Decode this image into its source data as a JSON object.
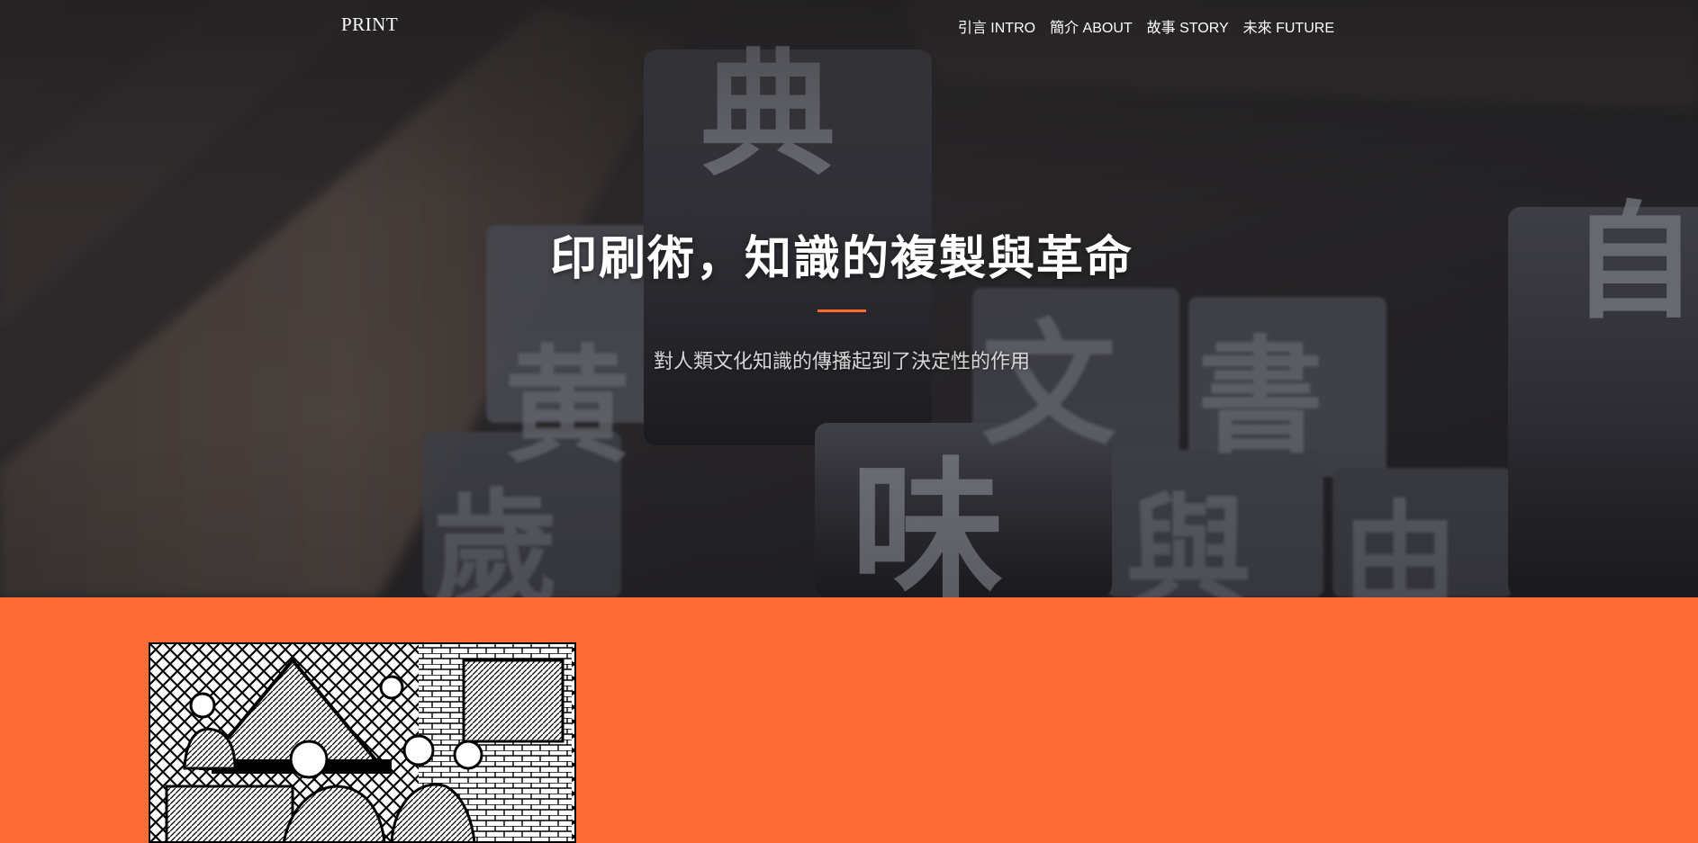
{
  "nav": {
    "brand": "PRINT",
    "items": [
      {
        "label": "引言 INTRO"
      },
      {
        "label": "簡介 ABOUT"
      },
      {
        "label": "故事 STORY"
      },
      {
        "label": "未來 FUTURE"
      }
    ]
  },
  "hero": {
    "title": "印刷術，知識的複製與革命",
    "subtitle": "對人類文化知識的傳播起到了決定性的作用",
    "background_image": "movable-type-blocks-photo",
    "type_block_glyphs": [
      "典",
      "味",
      "黄",
      "歲",
      "文",
      "書",
      "與",
      "由",
      "自"
    ]
  },
  "section": {
    "image": "printing-press-woodcut-illustration"
  },
  "colors": {
    "accent": "#ff6b35",
    "hero_text": "#ffffff",
    "subtitle_text": "#d6d6d6",
    "hero_dark": "#2b2a2b"
  }
}
